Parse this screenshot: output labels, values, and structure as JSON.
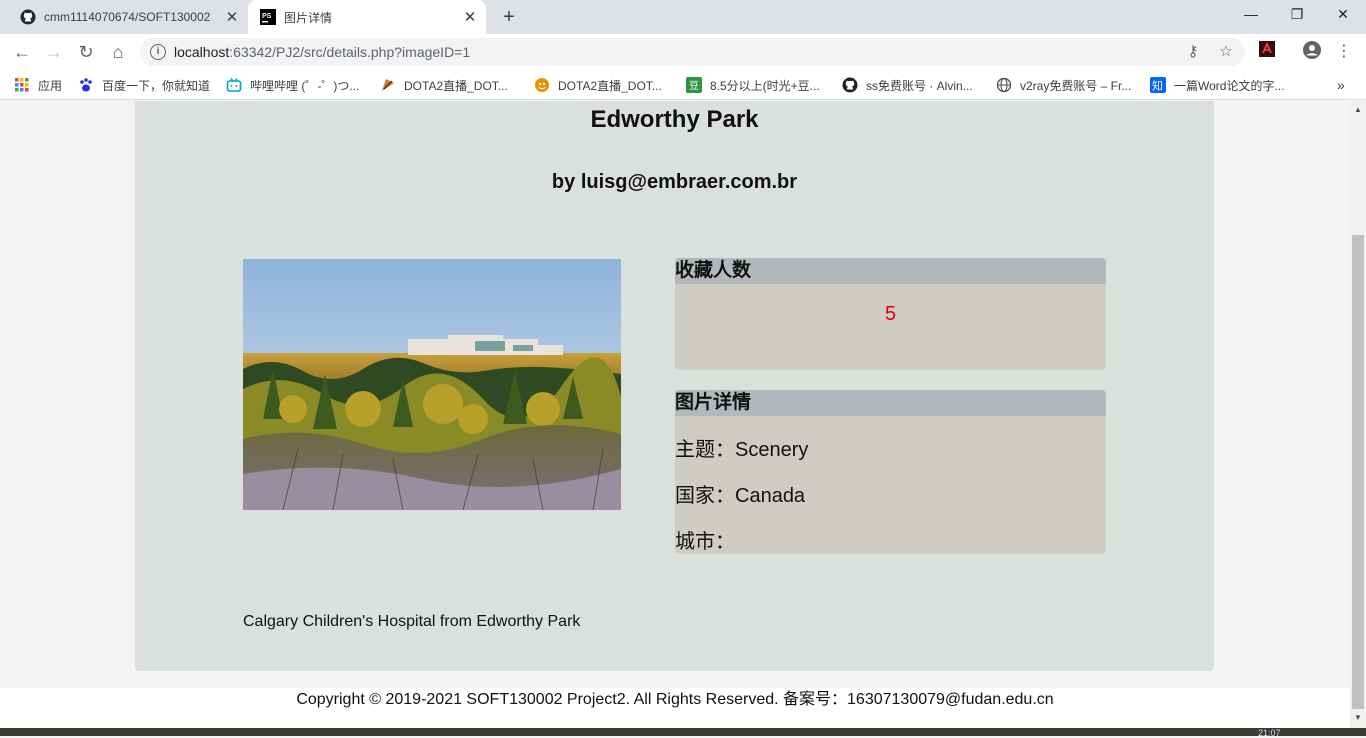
{
  "browser": {
    "tabs": [
      {
        "title": "cmm1114070674/SOFT130002",
        "active": false,
        "icon": "github-icon"
      },
      {
        "title": "图片详情",
        "active": true,
        "icon": "phpstorm-icon"
      }
    ],
    "new_tab": "+",
    "window_controls": {
      "minimize": "—",
      "maximize": "❐",
      "close": "✕"
    },
    "address": {
      "host": "localhost",
      "path": ":63342/PJ2/src/details.php?imageID=1"
    },
    "bookmarks": [
      {
        "label": "应用",
        "icon": "apps-grid-icon",
        "color": "#e8453c"
      },
      {
        "label": "百度一下，你就知道",
        "icon": "baidu-paw-icon",
        "color": "#2932e1"
      },
      {
        "label": "哔哩哔哩 (゜-゜)つ...",
        "icon": "bilibili-icon",
        "color": "#00a1d6"
      },
      {
        "label": "DOTA2直播_DOT...",
        "icon": "dota-icon",
        "color": "#a33"
      },
      {
        "label": "DOTA2直播_DOT...",
        "icon": "douyu-icon",
        "color": "#f09000"
      },
      {
        "label": "8.5分以上(时光+豆...",
        "icon": "douban-icon",
        "color": "#2e963d"
      },
      {
        "label": "ss免费账号 · Alvin...",
        "icon": "github-icon",
        "color": "#222"
      },
      {
        "label": "v2ray免费账号 – Fr...",
        "icon": "globe-icon",
        "color": "#555"
      },
      {
        "label": "一篇Word论文的字...",
        "icon": "zhihu-icon",
        "color": "#0066ff"
      }
    ],
    "bookmarks_overflow": "»"
  },
  "page": {
    "title": "Edworthy Park",
    "author": "by luisg@embraer.com.br",
    "favorites": {
      "heading": "收藏人数",
      "count": "5"
    },
    "details": {
      "heading": "图片详情",
      "theme_label": "主题：",
      "theme": "Scenery",
      "country_label": "国家：",
      "country": "Canada",
      "city_label": "城市：",
      "city": ""
    },
    "description": "Calgary Children's Hospital from Edworthy Park",
    "footer": "Copyright © 2019-2021 SOFT130002 Project2. All Rights Reserved. 备案号：16307130079@fudan.edu.cn"
  },
  "taskbar": {
    "clock": "21:07"
  }
}
